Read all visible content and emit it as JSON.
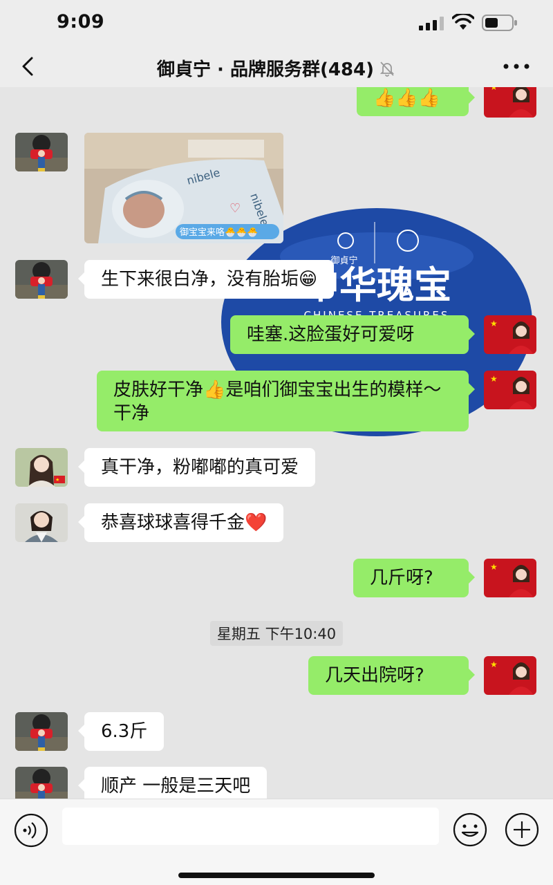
{
  "status_bar": {
    "time": "9:09"
  },
  "header": {
    "title": "御貞宁 · 品牌服务群(484)"
  },
  "messages": [
    {
      "text": "👍👍👍"
    },
    {
      "photo_caption": "御宝宝来咯🐣🐣🐣"
    },
    {
      "text": "生下来很白净，没有胎垢😁"
    },
    {
      "text": "哇塞.这脸蛋好可爱呀"
    },
    {
      "text": "皮肤好干净👍是咱们御宝宝出生的模样～干净"
    },
    {
      "text": "真干净，粉嘟嘟的真可爱"
    },
    {
      "text": "恭喜球球喜得千金❤️"
    },
    {
      "text": "几斤呀?"
    },
    {
      "text": "几天出院呀?"
    },
    {
      "text": "6.3斤"
    },
    {
      "text": "顺产 一般是三天吧"
    }
  ],
  "timestamp": "星期五 下午10:40",
  "background_brand": {
    "name": "御貞宁",
    "title": "中华瑰宝",
    "subtitle": "CHINESE TREASURES"
  },
  "input": {
    "value": "",
    "placeholder": ""
  },
  "colors": {
    "bubble_self": "#95ec69",
    "bubble_other": "#ffffff",
    "chat_bg": "#e5e5e5",
    "brand_blue": "#1e4aa6"
  },
  "icons": [
    "back-icon",
    "mute-icon",
    "more-icon",
    "voice-icon",
    "emoji-icon",
    "plus-icon"
  ]
}
